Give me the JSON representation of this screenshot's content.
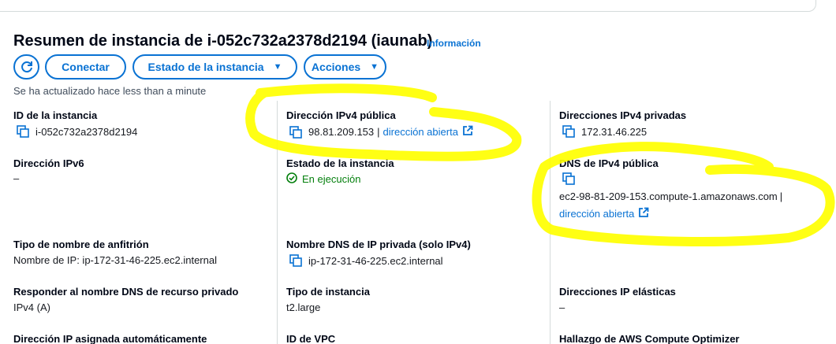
{
  "header": {
    "title": "Resumen de instancia de i-052c732a2378d2194 (iaunab)",
    "info_link": "Información"
  },
  "toolbar": {
    "connect": "Conectar",
    "instance_state": "Estado de la instancia",
    "actions": "Acciones",
    "updated": "Se ha actualizado hace less than a minute"
  },
  "fields": {
    "instance_id": {
      "label": "ID de la instancia",
      "value": "i-052c732a2378d2194"
    },
    "public_ipv4": {
      "label": "Dirección IPv4 pública",
      "value": "98.81.209.153",
      "sep": "|",
      "open": "dirección abierta"
    },
    "private_ipv4": {
      "label": "Direcciones IPv4 privadas",
      "value": "172.31.46.225"
    },
    "ipv6": {
      "label": "Dirección IPv6",
      "value": "–"
    },
    "instance_state": {
      "label": "Estado de la instancia",
      "value": "En ejecución"
    },
    "public_dns": {
      "label": "DNS de IPv4 pública",
      "value": "ec2-98-81-209-153.compute-1.amazonaws.com",
      "sep": "|",
      "open": "dirección abierta"
    },
    "hostname_type": {
      "label": "Tipo de nombre de anfitrión",
      "value": "Nombre de IP: ip-172-31-46-225.ec2.internal"
    },
    "private_dns": {
      "label": "Nombre DNS de IP privada (solo IPv4)",
      "value": "ip-172-31-46-225.ec2.internal"
    },
    "resource_dns": {
      "label": "Responder al nombre DNS de recurso privado",
      "value": "IPv4 (A)"
    },
    "instance_type": {
      "label": "Tipo de instancia",
      "value": "t2.large"
    },
    "elastic_ip": {
      "label": "Direcciones IP elásticas",
      "value": "–"
    },
    "auto_ip": {
      "label": "Dirección IP asignada automáticamente"
    },
    "vpc_id": {
      "label": "ID de VPC"
    },
    "optimizer": {
      "label": "Hallazgo de AWS Compute Optimizer"
    }
  },
  "icons": {
    "refresh": "refresh-icon",
    "caret": "caret-down-icon",
    "copy": "copy-icon",
    "external": "external-link-icon",
    "status": "check-circle-icon"
  },
  "colors": {
    "link": "#0972d3",
    "success": "#037f0c",
    "highlight": "#ffff00"
  }
}
